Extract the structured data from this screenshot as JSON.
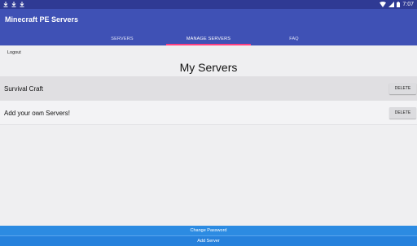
{
  "status_bar": {
    "time": "7:07",
    "icons": [
      "download-icon",
      "download-icon",
      "download-icon",
      "wifi-icon",
      "cellular-icon",
      "battery-icon"
    ]
  },
  "app_bar": {
    "title": "Minecraft PE Servers",
    "tabs": [
      {
        "label": "SERVERS",
        "active": false
      },
      {
        "label": "MANAGE SERVERS",
        "active": true
      },
      {
        "label": "FAQ",
        "active": false
      }
    ],
    "indicator_color": "#ff4081",
    "background_color": "#3f51b5"
  },
  "main": {
    "logout_label": "Logout",
    "title": "My Servers",
    "servers": [
      {
        "name": "Survival Craft",
        "delete_label": "DELETE"
      },
      {
        "name": "Add your own Servers!",
        "delete_label": "DELETE"
      }
    ]
  },
  "footer": {
    "change_password_label": "Change Password",
    "add_server_label": "Add Server",
    "button_color": "#2c8be2"
  }
}
